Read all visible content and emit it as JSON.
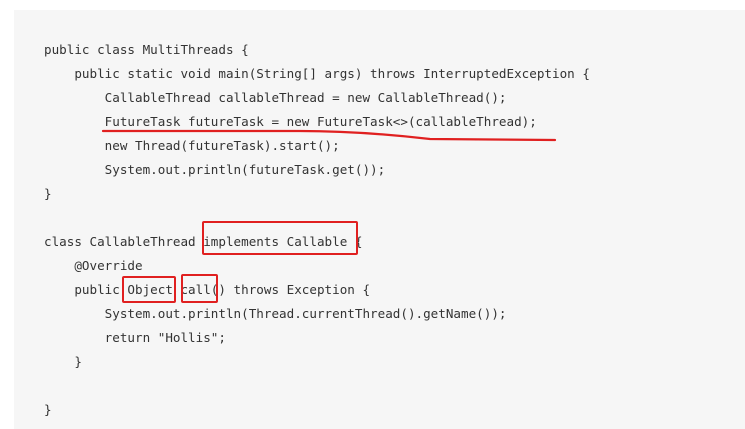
{
  "code_lines": [
    "public class MultiThreads {",
    "    public static void main(String[] args) throws InterruptedException {",
    "        CallableThread callableThread = new CallableThread();",
    "        FutureTask futureTask = new FutureTask<>(callableThread);",
    "        new Thread(futureTask).start();",
    "        System.out.println(futureTask.get());",
    "}",
    "",
    "class CallableThread implements Callable {",
    "    @Override",
    "    public Object call() throws Exception {",
    "        System.out.println(Thread.currentThread().getName());",
    "        return \"Hollis\";",
    "    }",
    "",
    "}"
  ],
  "colors": {
    "annotation": "#e02020",
    "panel_background": "#f6f6f6",
    "text": "#333333"
  }
}
